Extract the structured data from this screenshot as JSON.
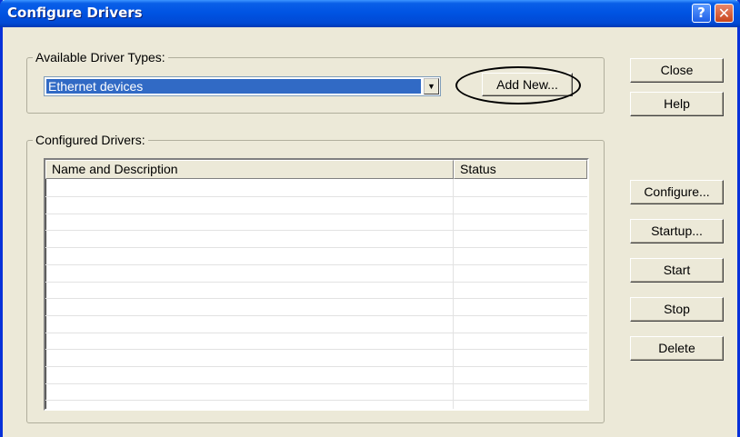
{
  "window": {
    "title": "Configure Drivers",
    "help_glyph": "?",
    "close_glyph": "✕"
  },
  "available_group": {
    "label": "Available Driver Types:",
    "selected_driver": "Ethernet devices",
    "dropdown_glyph": "▼",
    "add_new_label": "Add New..."
  },
  "configured_group": {
    "label": "Configured Drivers:",
    "columns": [
      "Name and Description",
      "Status"
    ],
    "rows": []
  },
  "side_buttons": {
    "close": "Close",
    "help": "Help",
    "configure": "Configure...",
    "startup": "Startup...",
    "start": "Start",
    "stop": "Stop",
    "delete": "Delete"
  },
  "colors": {
    "titlebar": "#0054e3",
    "selection": "#316ac5",
    "dialog_bg": "#ece9d8"
  }
}
